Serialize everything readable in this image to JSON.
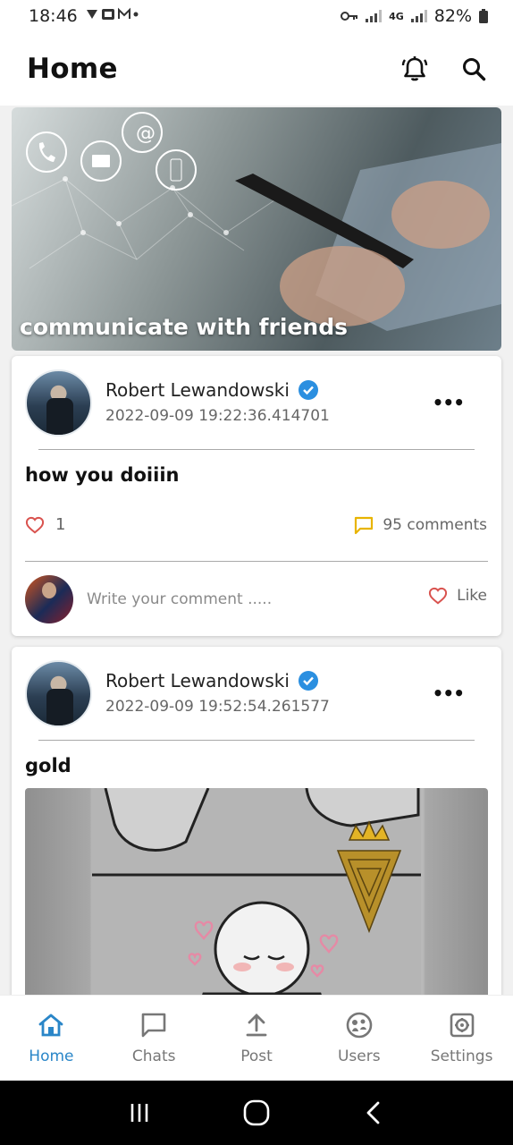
{
  "status_bar": {
    "time": "18:46",
    "network": "4G",
    "battery": "82%"
  },
  "app_bar": {
    "title": "Home",
    "icons": [
      "bell-icon",
      "search-icon"
    ]
  },
  "banner": {
    "caption": "communicate with friends"
  },
  "posts": [
    {
      "author": "Robert Lewandowski",
      "verified": true,
      "date": "2022-09-09 19:22:36.414701",
      "text": "how you doiiin",
      "likes": "1",
      "comments": "95 comments",
      "comment_placeholder": "Write your comment .....",
      "like_label": "Like"
    },
    {
      "author": "Robert Lewandowski",
      "verified": true,
      "date": "2022-09-09 19:52:54.261577",
      "text": "gold"
    }
  ],
  "bottom_nav": {
    "items": [
      {
        "label": "Home",
        "icon": "home-icon",
        "active": true
      },
      {
        "label": "Chats",
        "icon": "chat-icon",
        "active": false
      },
      {
        "label": "Post",
        "icon": "upload-icon",
        "active": false
      },
      {
        "label": "Users",
        "icon": "users-icon",
        "active": false
      },
      {
        "label": "Settings",
        "icon": "settings-icon",
        "active": false
      }
    ]
  },
  "colors": {
    "accent": "#2a86c8",
    "heart": "#d9534f",
    "comment": "#e8b400",
    "verified": "#2b8fe0"
  }
}
